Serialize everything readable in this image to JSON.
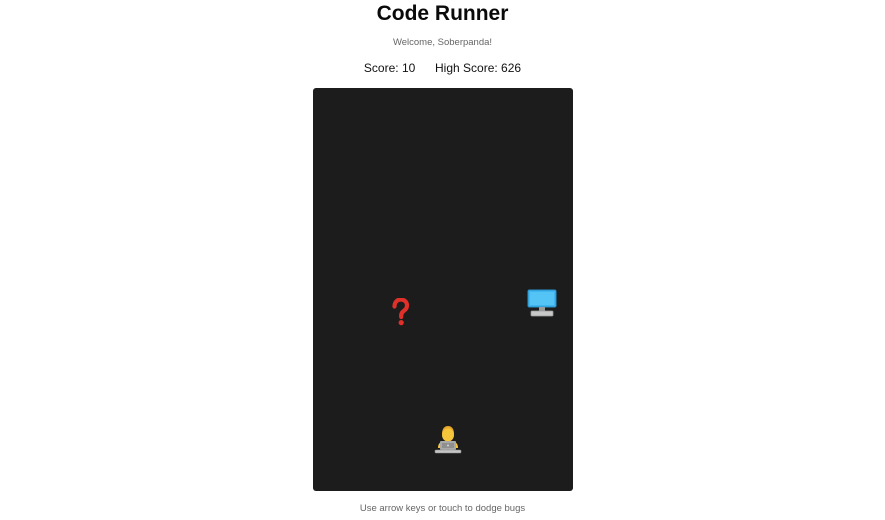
{
  "game": {
    "title": "Code Runner",
    "welcome": "Welcome, Soberpanda!",
    "score_label": "Score:",
    "score_value": "10",
    "high_score_label": "High Score:",
    "high_score_value": "626",
    "instructions": "Use arrow keys or touch to dodge bugs"
  },
  "board": {
    "background": "#1c1c1c",
    "sprites": {
      "bug": {
        "icon": "question-mark-icon",
        "color": "#e0302a"
      },
      "computer": {
        "icon": "desktop-computer-icon",
        "color": "#3fb6f0"
      },
      "player": {
        "icon": "developer-at-laptop-icon",
        "color": "#f5c63c"
      }
    }
  }
}
